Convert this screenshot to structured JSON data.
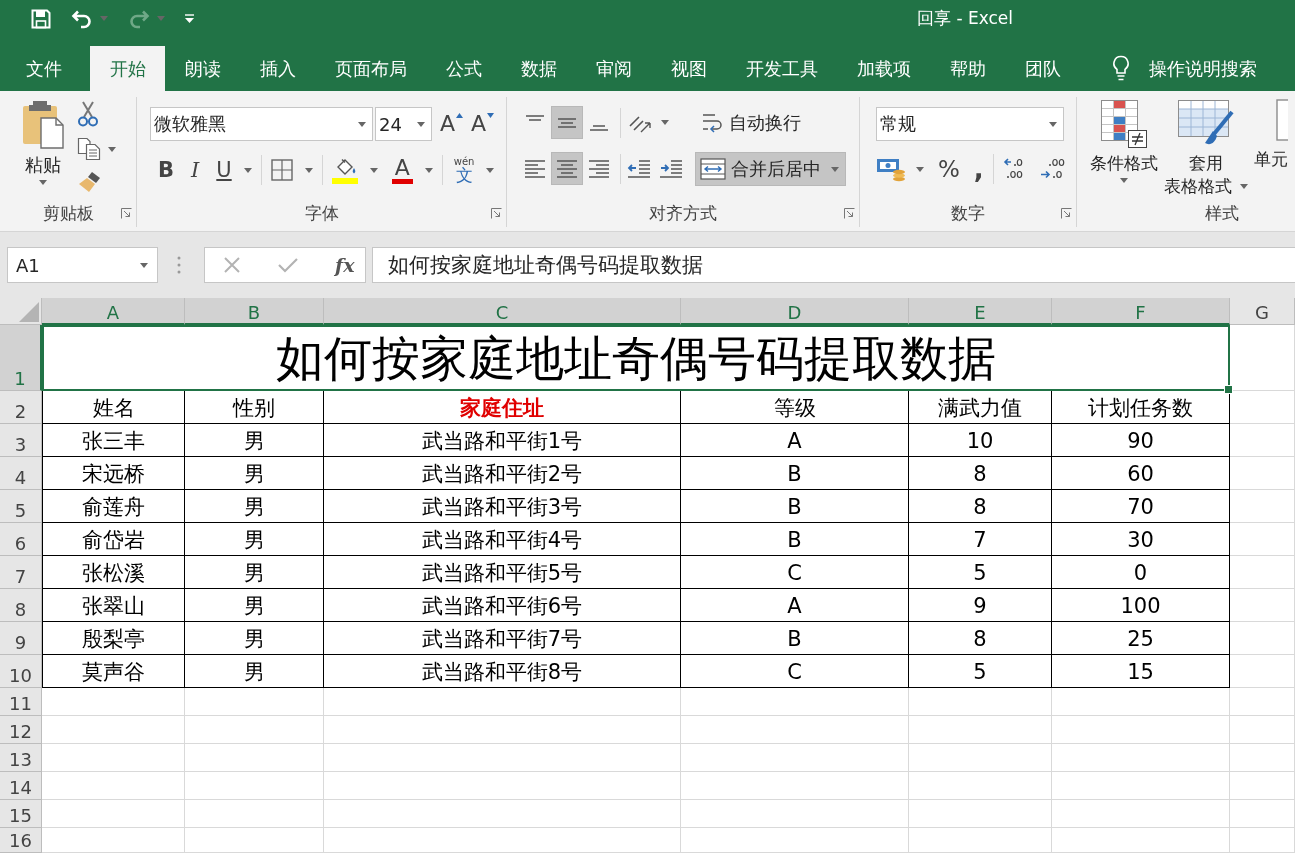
{
  "window": {
    "title": "回享 - Excel"
  },
  "quick_access": [
    {
      "kind": "save",
      "disabled": false
    },
    {
      "kind": "undo",
      "disabled": false
    },
    {
      "kind": "redo",
      "disabled": true
    },
    {
      "kind": "customize",
      "disabled": false
    }
  ],
  "tabs": [
    {
      "label": "文件",
      "selected": false
    },
    {
      "label": "开始",
      "selected": true
    },
    {
      "label": "朗读",
      "selected": false
    },
    {
      "label": "插入",
      "selected": false
    },
    {
      "label": "页面布局",
      "selected": false
    },
    {
      "label": "公式",
      "selected": false
    },
    {
      "label": "数据",
      "selected": false
    },
    {
      "label": "审阅",
      "selected": false
    },
    {
      "label": "视图",
      "selected": false
    },
    {
      "label": "开发工具",
      "selected": false
    },
    {
      "label": "加载项",
      "selected": false
    },
    {
      "label": "帮助",
      "selected": false
    },
    {
      "label": "团队",
      "selected": false
    }
  ],
  "tell_me": {
    "label": "操作说明搜索"
  },
  "ribbon": {
    "clipboard": {
      "label": "剪贴板",
      "paste": "粘贴"
    },
    "font": {
      "label": "字体",
      "font_name": "微软雅黑",
      "font_size": "24",
      "grow": "A",
      "shrink": "A",
      "bold": "B",
      "italic": "I",
      "underline": "U",
      "font_color": "A",
      "phonetic_reading": "wén",
      "phonetic_char": "文"
    },
    "alignment": {
      "label": "对齐方式",
      "vertical": [
        {
          "kind": "top",
          "on": false
        },
        {
          "kind": "middle",
          "on": true
        },
        {
          "kind": "bottom",
          "on": false
        }
      ],
      "horizontal": [
        {
          "kind": "left",
          "on": false
        },
        {
          "kind": "center",
          "on": true
        },
        {
          "kind": "right",
          "on": false
        }
      ],
      "wrap_text": {
        "label": "自动换行",
        "on": false
      },
      "merge": {
        "label": "合并后居中",
        "on": true
      }
    },
    "number": {
      "label": "数字",
      "format": "常规",
      "percent": "%",
      "comma": ","
    },
    "styles": {
      "label": "样式",
      "buttons": [
        {
          "kind": "conditional",
          "lines": [
            "条件格式"
          ],
          "dropdown": true
        },
        {
          "kind": "table",
          "lines": [
            "套用",
            "表格格式"
          ],
          "dropdown": true
        },
        {
          "kind": "cell",
          "lines": [
            "单元"
          ],
          "dropdown": false
        }
      ]
    }
  },
  "formula_bar": {
    "name_box": "A1",
    "function_label": "fx",
    "formula": "如何按家庭地址奇偶号码提取数据"
  },
  "sheet": {
    "columns": [
      {
        "label": "A",
        "selected": true
      },
      {
        "label": "B",
        "selected": true
      },
      {
        "label": "C",
        "selected": true
      },
      {
        "label": "D",
        "selected": true
      },
      {
        "label": "E",
        "selected": true
      },
      {
        "label": "F",
        "selected": true
      },
      {
        "label": "G",
        "selected": false
      }
    ],
    "rows": [
      {
        "label": "1",
        "selected": true
      },
      {
        "label": "2",
        "selected": false
      },
      {
        "label": "3",
        "selected": false
      },
      {
        "label": "4",
        "selected": false
      },
      {
        "label": "5",
        "selected": false
      },
      {
        "label": "6",
        "selected": false
      },
      {
        "label": "7",
        "selected": false
      },
      {
        "label": "8",
        "selected": false
      },
      {
        "label": "9",
        "selected": false
      },
      {
        "label": "10",
        "selected": false
      },
      {
        "label": "11",
        "selected": false
      },
      {
        "label": "12",
        "selected": false
      },
      {
        "label": "13",
        "selected": false
      },
      {
        "label": "14",
        "selected": false
      },
      {
        "label": "15",
        "selected": false
      },
      {
        "label": "16",
        "selected": false
      }
    ],
    "title": "如何按家庭地址奇偶号码提取数据",
    "header": [
      {
        "text": "姓名",
        "emphasis": false
      },
      {
        "text": "性别",
        "emphasis": false
      },
      {
        "text": "家庭住址",
        "emphasis": true
      },
      {
        "text": "等级",
        "emphasis": false
      },
      {
        "text": "满武力值",
        "emphasis": false
      },
      {
        "text": "计划任务数",
        "emphasis": false
      }
    ],
    "data": [
      [
        "张三丰",
        "男",
        "武当路和平街1号",
        "A",
        "10",
        "90"
      ],
      [
        "宋远桥",
        "男",
        "武当路和平街2号",
        "B",
        "8",
        "60"
      ],
      [
        "俞莲舟",
        "男",
        "武当路和平街3号",
        "B",
        "8",
        "70"
      ],
      [
        "俞岱岩",
        "男",
        "武当路和平街4号",
        "B",
        "7",
        "30"
      ],
      [
        "张松溪",
        "男",
        "武当路和平街5号",
        "C",
        "5",
        "0"
      ],
      [
        "张翠山",
        "男",
        "武当路和平街6号",
        "A",
        "9",
        "100"
      ],
      [
        "殷梨亭",
        "男",
        "武当路和平街7号",
        "B",
        "8",
        "25"
      ],
      [
        "莫声谷",
        "男",
        "武当路和平街8号",
        "C",
        "5",
        "15"
      ]
    ]
  }
}
